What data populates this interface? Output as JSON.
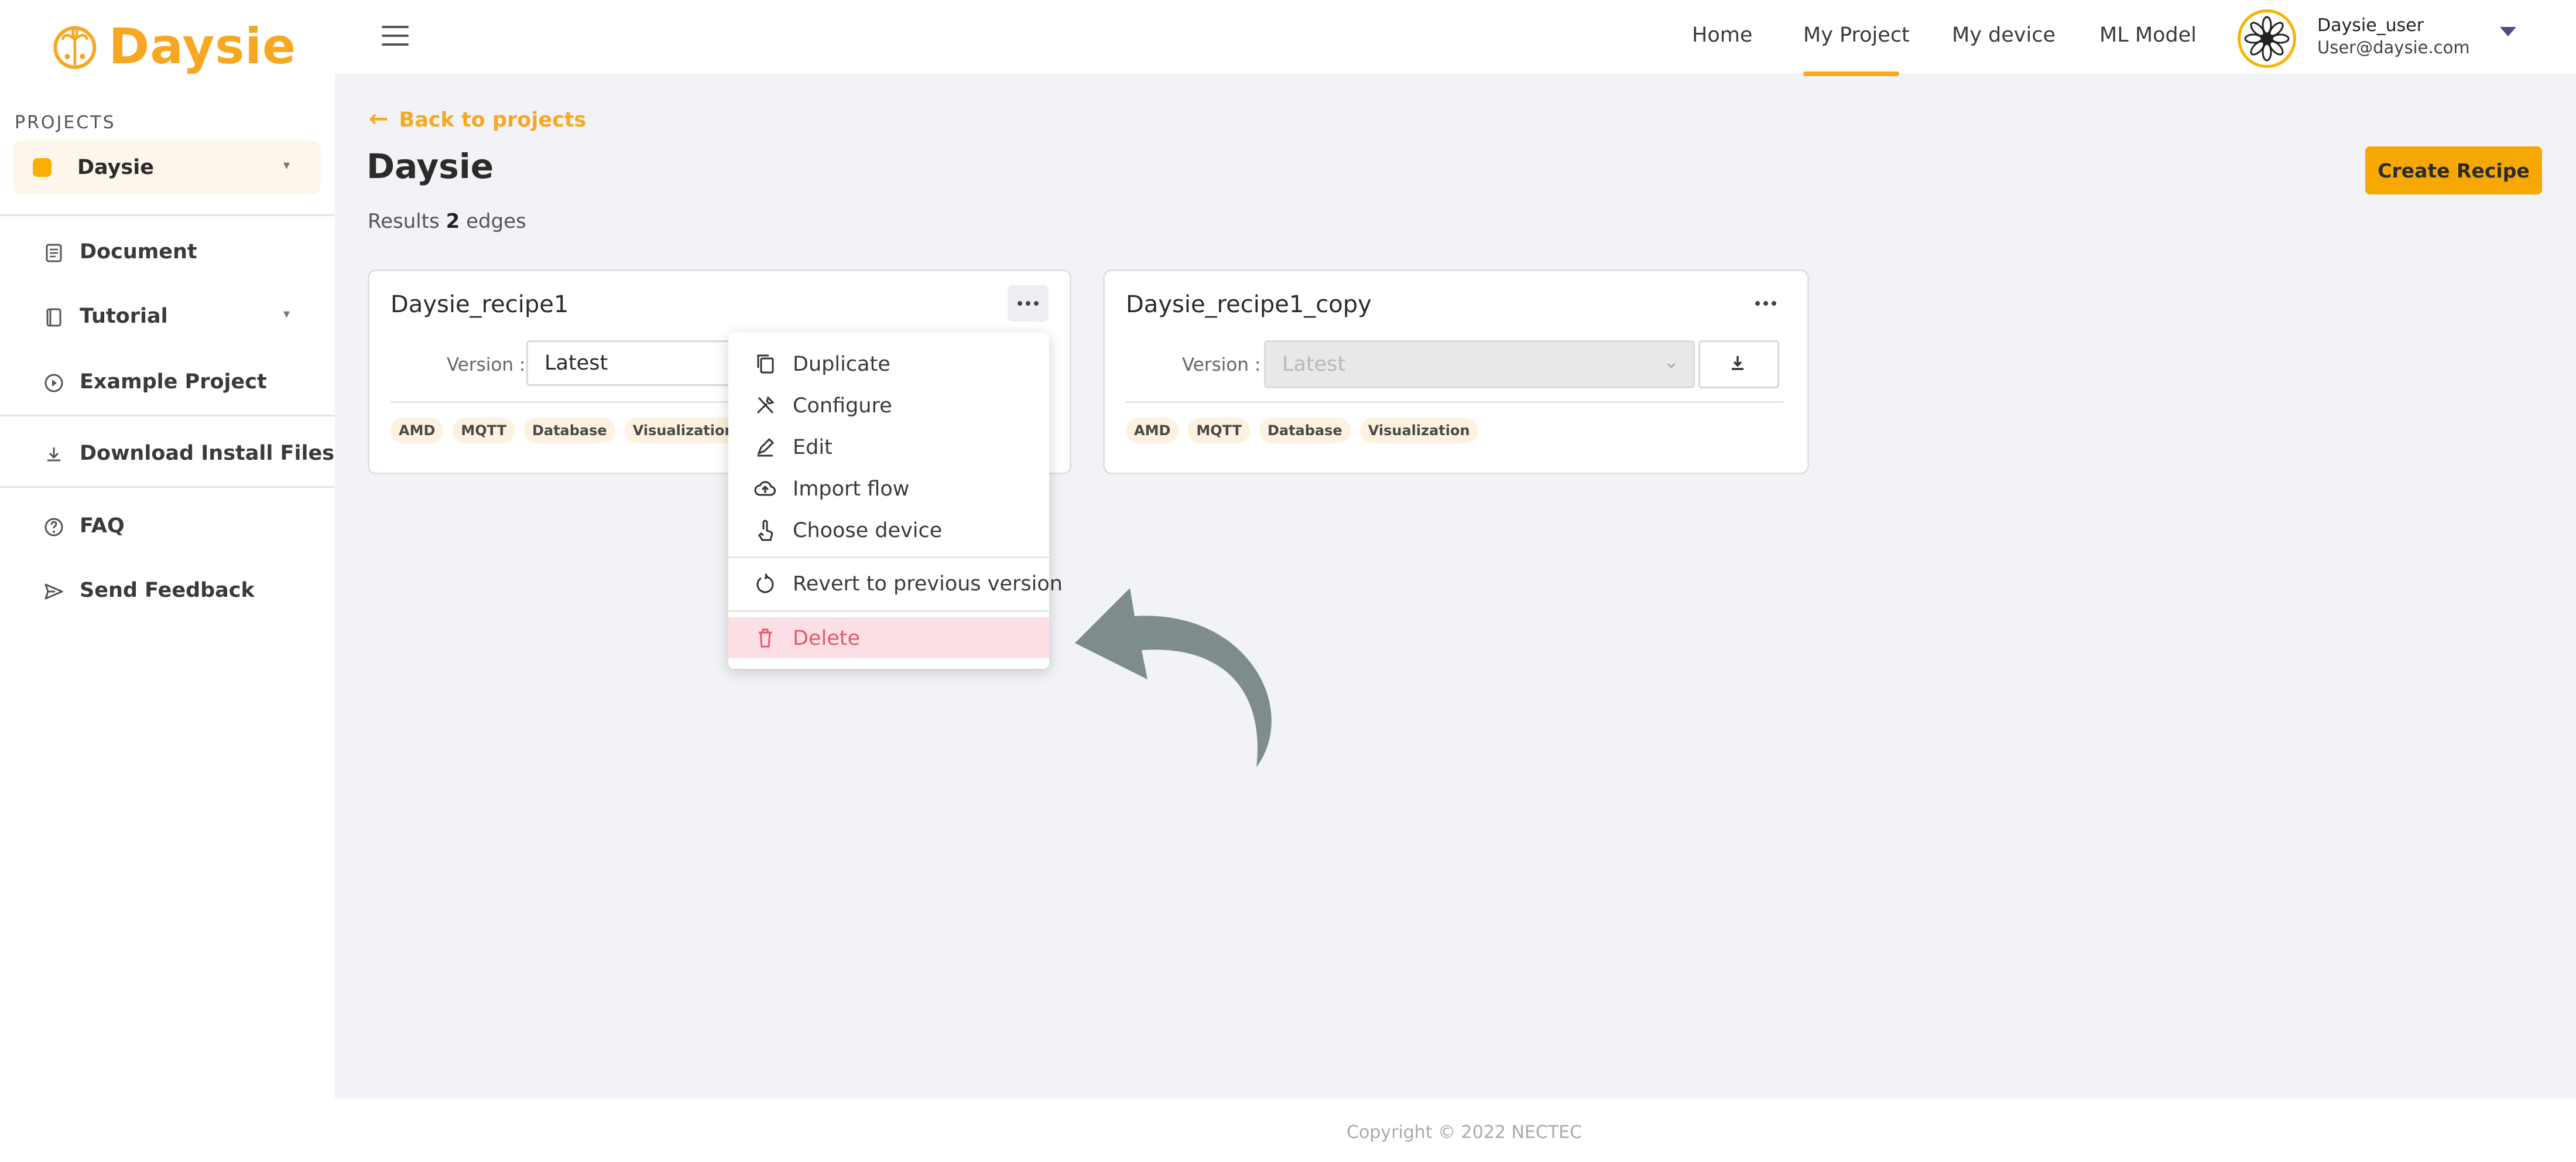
{
  "app": {
    "logo_text": "Daysie",
    "brand_color": "#f7a823"
  },
  "sidebar": {
    "section_label": "PROJECTS",
    "project_select": {
      "value": "Daysie"
    },
    "items": [
      {
        "label": "Document",
        "icon": "document-icon"
      },
      {
        "label": "Tutorial",
        "icon": "book-icon"
      },
      {
        "label": "Example Project",
        "icon": "play-circle-icon"
      },
      {
        "label": "Download Install Files",
        "icon": "download-icon"
      },
      {
        "label": "FAQ",
        "icon": "help-circle-icon"
      },
      {
        "label": "Send Feedback",
        "icon": "send-icon"
      }
    ]
  },
  "header": {
    "nav": [
      "Home",
      "My Project",
      "My device",
      "ML Model"
    ],
    "active_nav": "My Project",
    "user": {
      "name": "Daysie_user",
      "email": "User@daysie.com"
    }
  },
  "page": {
    "back_label": "Back to projects",
    "title": "Daysie",
    "results_prefix": "Results",
    "results_count": "2",
    "results_suffix": "edges",
    "create_button": "Create Recipe"
  },
  "cards": [
    {
      "title": "Daysie_recipe1",
      "version_label": "Version :",
      "version_value": "Latest",
      "tags": [
        "AMD",
        "MQTT",
        "Database",
        "Visualization"
      ]
    },
    {
      "title": "Daysie_recipe1_copy",
      "version_label": "Version :",
      "version_value": "Latest",
      "tags": [
        "AMD",
        "MQTT",
        "Database",
        "Visualization"
      ]
    }
  ],
  "context_menu": {
    "items": [
      {
        "label": "Duplicate",
        "icon": "copy-icon"
      },
      {
        "label": "Configure",
        "icon": "tools-icon"
      },
      {
        "label": "Edit",
        "icon": "edit-icon"
      },
      {
        "label": "Import flow",
        "icon": "cloud-upload-icon"
      },
      {
        "label": "Choose device",
        "icon": "touch-icon"
      },
      {
        "label": "Revert to previous version",
        "icon": "revert-icon"
      },
      {
        "label": "Delete",
        "icon": "trash-icon"
      }
    ],
    "highlighted": "Delete"
  },
  "footer": {
    "copyright": "Copyright © 2022 NECTEC"
  },
  "colors": {
    "accent": "#f7a823",
    "danger": "#e45a6a",
    "arrow": "#7f8c8d"
  }
}
